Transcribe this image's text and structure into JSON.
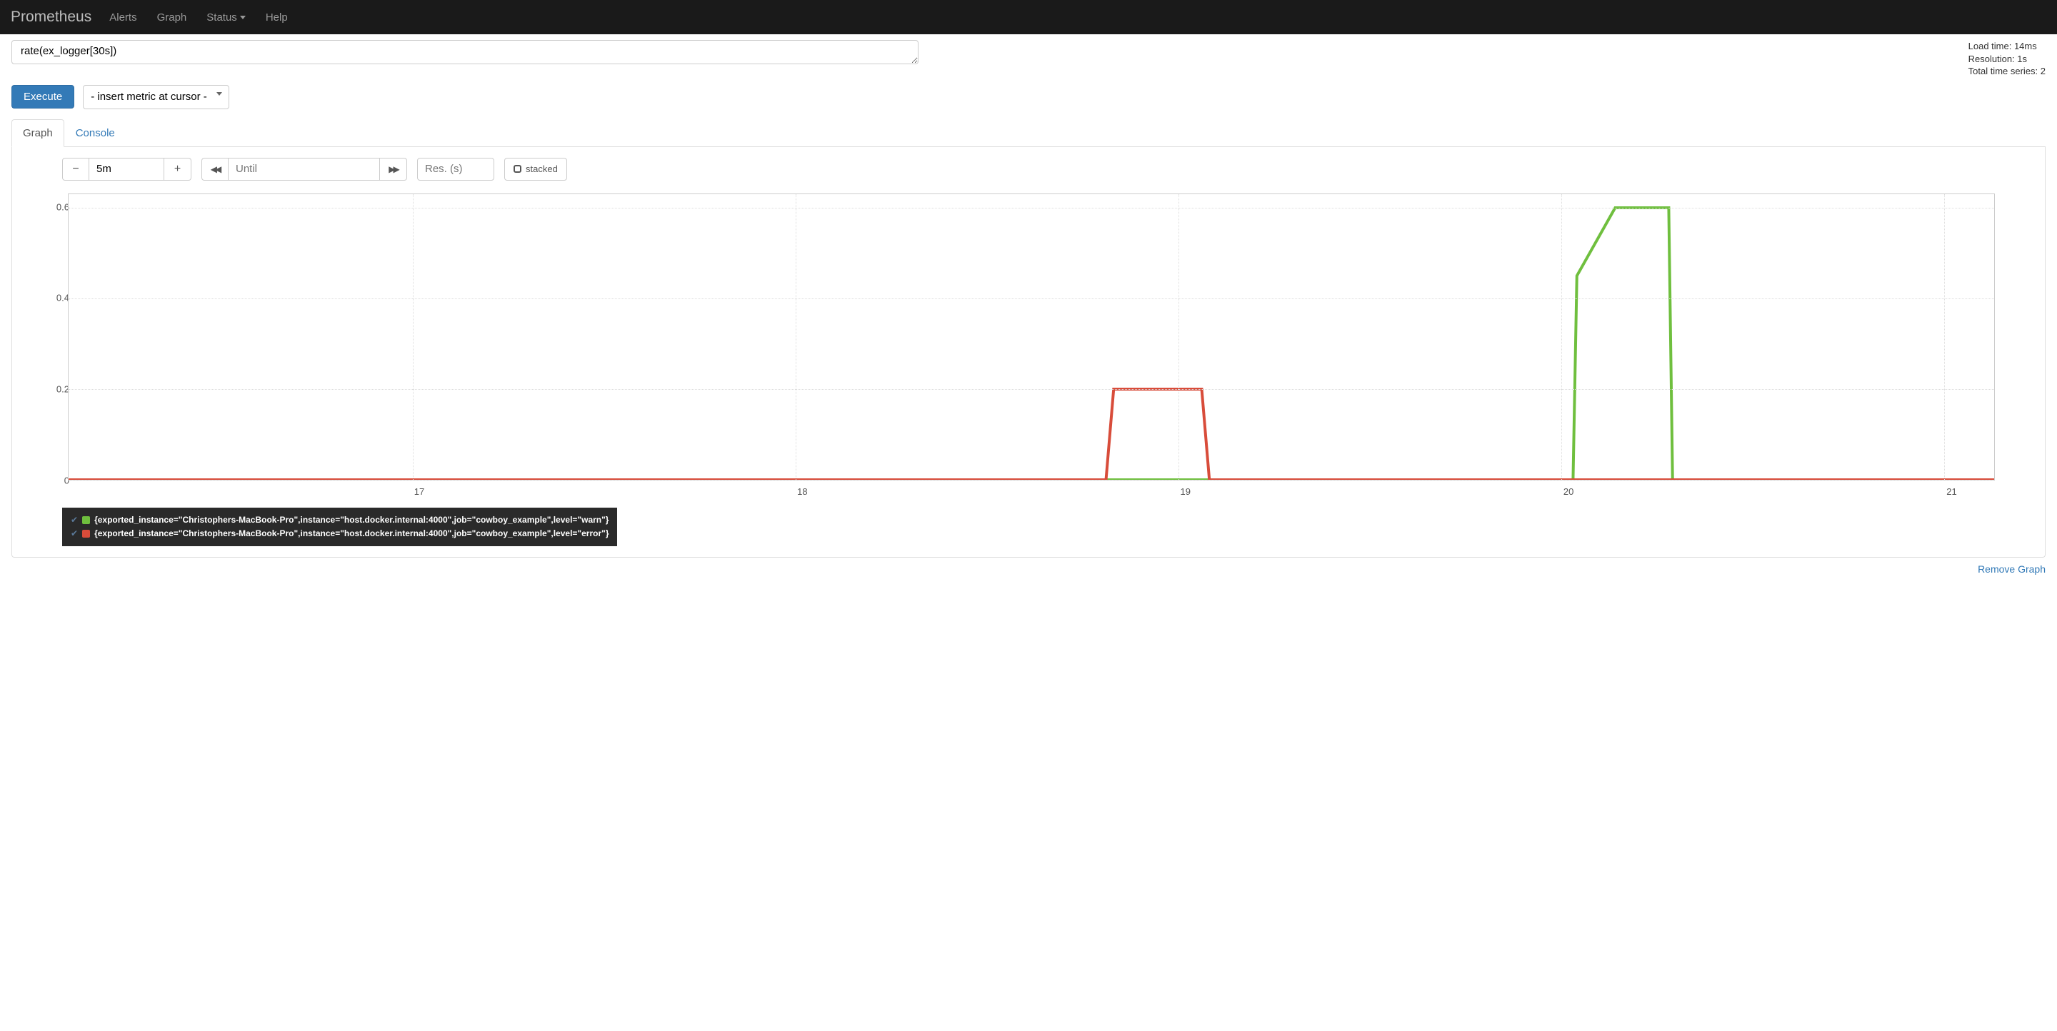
{
  "nav": {
    "brand": "Prometheus",
    "links": {
      "alerts": "Alerts",
      "graph": "Graph",
      "status": "Status",
      "help": "Help"
    }
  },
  "query": {
    "expression": "rate(ex_logger[30s])"
  },
  "stats": {
    "load_time": "Load time: 14ms",
    "resolution": "Resolution: 1s",
    "total_series": "Total time series: 2"
  },
  "buttons": {
    "execute": "Execute",
    "metric_placeholder": "- insert metric at cursor -",
    "stacked": "stacked",
    "remove_graph": "Remove Graph"
  },
  "tabs": {
    "graph": "Graph",
    "console": "Console"
  },
  "range": {
    "value": "5m",
    "until_placeholder": "Until",
    "res_placeholder": "Res. (s)"
  },
  "chart_data": {
    "type": "line",
    "yticks": [
      0,
      0.2,
      0.4,
      0.6
    ],
    "xticks": [
      "17",
      "18",
      "19",
      "20",
      "21"
    ],
    "ylim": [
      0,
      0.63
    ],
    "xlabel": "",
    "ylabel": "",
    "series": [
      {
        "name": "{exported_instance=\"Christophers-MacBook-Pro\",instance=\"host.docker.internal:4000\",job=\"cowboy_example\",level=\"warn\"}",
        "color": "#6fbf3e",
        "x": [
          16.1,
          18.44,
          18.44,
          20.03,
          20.04,
          20.14,
          20.28,
          20.29,
          21.13
        ],
        "values": [
          0,
          0,
          0,
          0,
          0.45,
          0.6,
          0.6,
          0,
          0
        ]
      },
      {
        "name": "{exported_instance=\"Christophers-MacBook-Pro\",instance=\"host.docker.internal:4000\",job=\"cowboy_example\",level=\"error\"}",
        "color": "#d84c3a",
        "x": [
          16.1,
          18.81,
          18.83,
          19.06,
          19.08,
          21.13
        ],
        "values": [
          0,
          0,
          0.2,
          0.2,
          0,
          0
        ]
      }
    ]
  },
  "legend": [
    {
      "color": "#6fbf3e",
      "label": "{exported_instance=\"Christophers-MacBook-Pro\",instance=\"host.docker.internal:4000\",job=\"cowboy_example\",level=\"warn\"}"
    },
    {
      "color": "#d84c3a",
      "label": "{exported_instance=\"Christophers-MacBook-Pro\",instance=\"host.docker.internal:4000\",job=\"cowboy_example\",level=\"error\"}"
    }
  ]
}
